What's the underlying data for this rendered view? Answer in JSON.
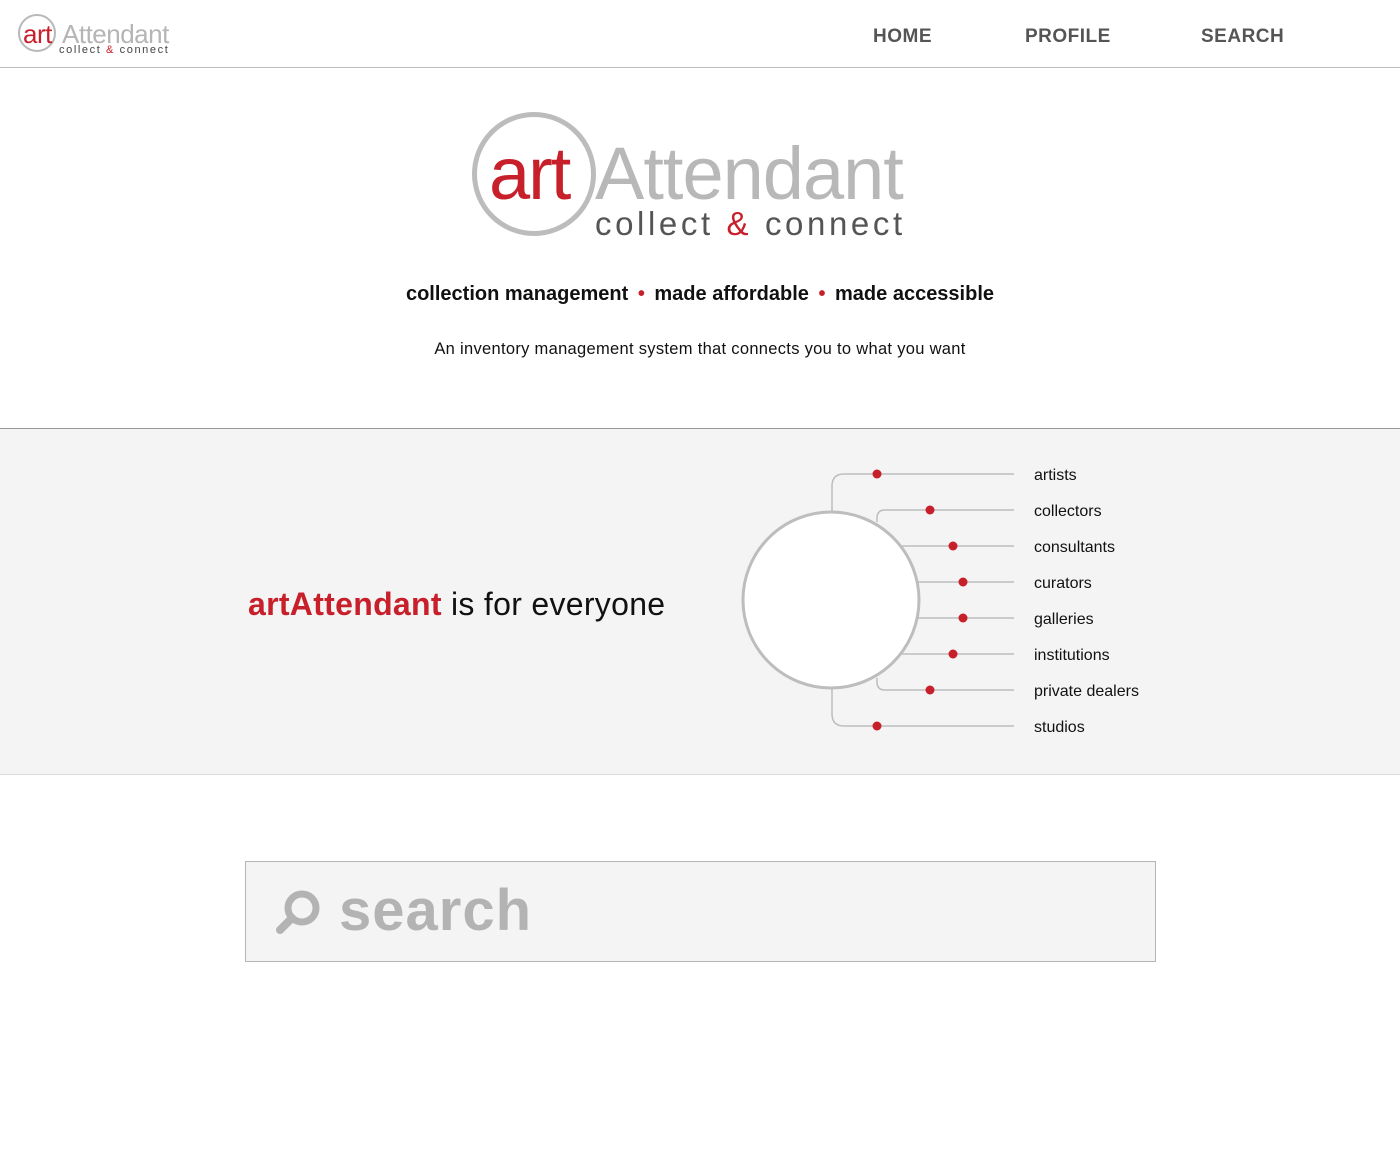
{
  "brand": {
    "art": "art",
    "attendant": "Attendant",
    "tag_collect": "collect",
    "tag_amp": "&",
    "tag_connect": "connect",
    "accent_color": "#c8202b",
    "gray_color": "#b8b8b8"
  },
  "nav": {
    "home": "HOME",
    "profile": "PROFILE",
    "search": "SEARCH"
  },
  "hero": {
    "tagline": [
      "collection management",
      "made affordable",
      "made accessible"
    ],
    "tagline_sep": "•",
    "subtext": "An inventory management system that connects you to what you want"
  },
  "audience": {
    "brand": "artAttendant",
    "heading_rest": " is for everyone",
    "items": [
      "artists",
      "collectors",
      "consultants",
      "curators",
      "galleries",
      "institutions",
      "private dealers",
      "studios"
    ]
  },
  "search": {
    "placeholder": "search",
    "icon": "search-icon"
  }
}
